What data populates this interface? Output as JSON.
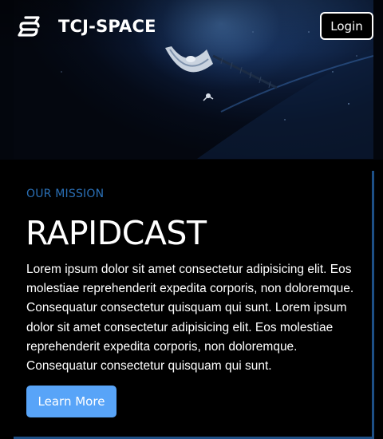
{
  "header": {
    "brand": "TCJ-SPACE",
    "logo_icon": "stylized-s-logo-icon",
    "login_label": "Login"
  },
  "hero": {
    "image": "satellite-orbiting-earth-photo"
  },
  "mission": {
    "eyebrow": "OUR MISSION",
    "title": "RAPIDCAST",
    "body": "Lorem ipsum dolor sit amet consectetur adipisicing elit. Eos molestiae reprehenderit expedita corporis, non doloremque. Consequatur consectetur quisquam qui sunt. Lorem ipsum dolor sit amet consectetur adipisicing elit. Eos molestiae reprehenderit expedita corporis, non doloremque. Consequatur consectetur quisquam qui sunt.",
    "button_label": "Learn More"
  },
  "colors": {
    "background": "#000000",
    "accent_blue": "#58a4f8",
    "eyebrow_blue": "#2a6fb5",
    "card_border": "#1d4f86"
  }
}
